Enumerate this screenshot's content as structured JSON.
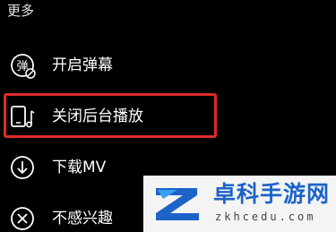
{
  "menu": {
    "section_title": "更多",
    "items": [
      {
        "label": "开启弹幕",
        "icon": "danmaku-icon",
        "icon_text": "弹"
      },
      {
        "label": "关闭后台播放",
        "icon": "phone-music-icon"
      },
      {
        "label": "下载MV",
        "icon": "download-icon"
      },
      {
        "label": "不感兴趣",
        "icon": "close-circle-icon"
      }
    ]
  },
  "highlight_color": "#e02a2a",
  "watermark": {
    "name": "卓科手游网",
    "domain": "zkhcedu.com",
    "color": "#1d63c8"
  }
}
